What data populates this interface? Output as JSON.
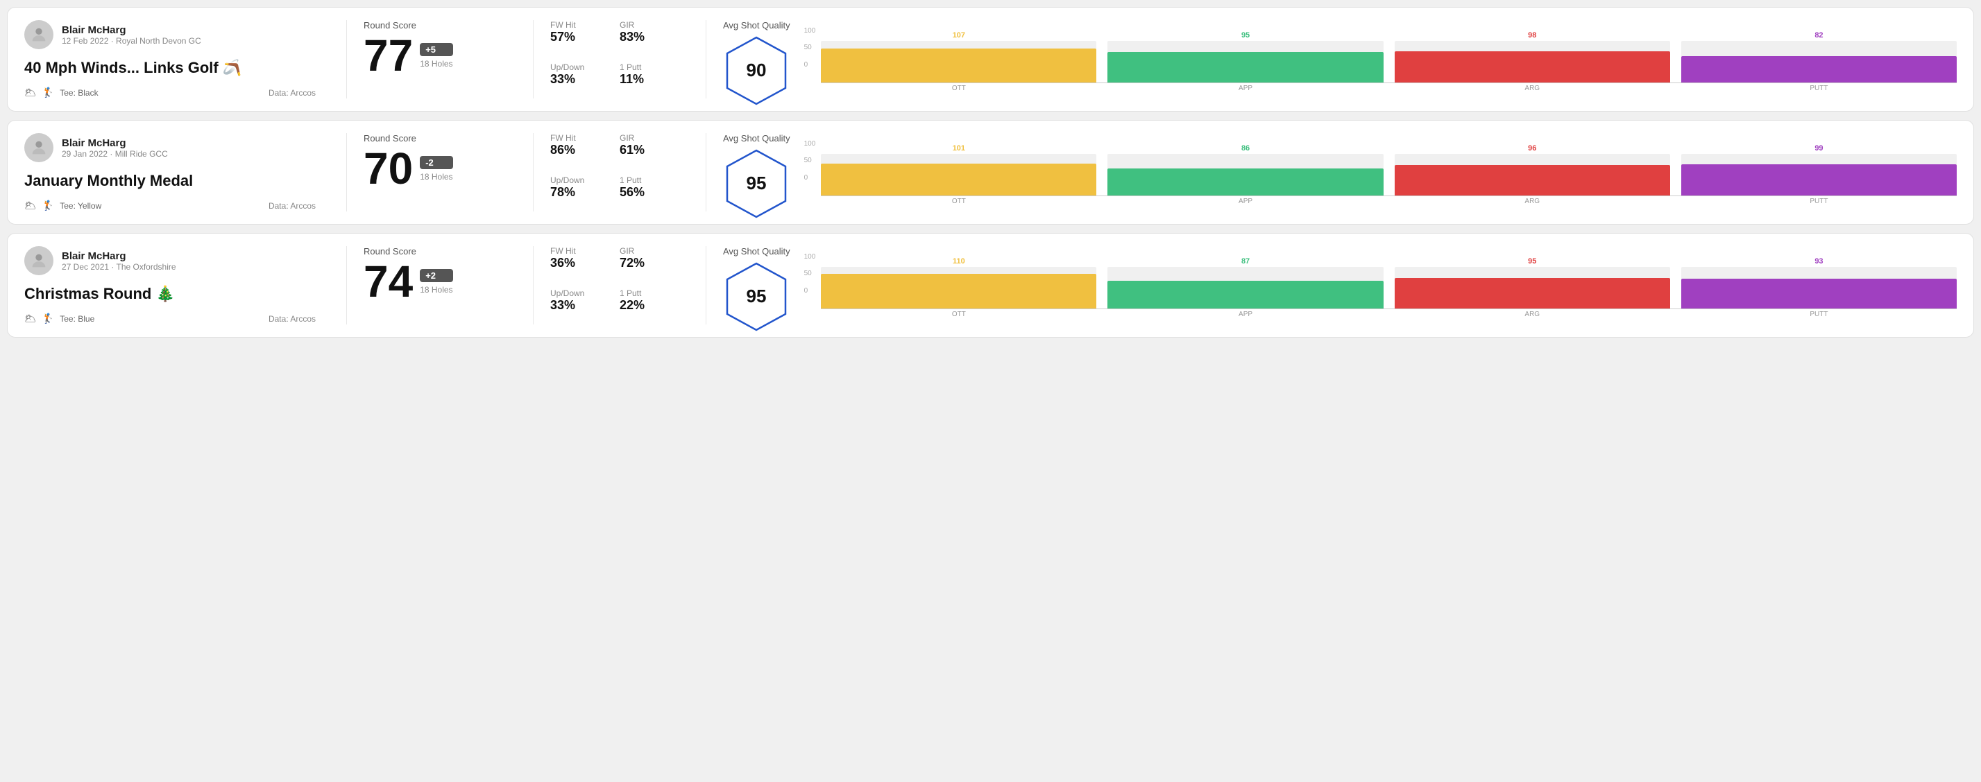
{
  "rounds": [
    {
      "id": "round-1",
      "user": {
        "name": "Blair McHarg",
        "meta": "12 Feb 2022 · Royal North Devon GC"
      },
      "title": "40 Mph Winds... Links Golf 🪃",
      "tee": "Black",
      "data_source": "Data: Arccos",
      "score": {
        "label": "Round Score",
        "number": "77",
        "badge": "+5",
        "badge_type": "plus",
        "holes": "18 Holes"
      },
      "stats": {
        "fw_hit_label": "FW Hit",
        "fw_hit_value": "57%",
        "gir_label": "GIR",
        "gir_value": "83%",
        "updown_label": "Up/Down",
        "updown_value": "33%",
        "oneputt_label": "1 Putt",
        "oneputt_value": "11%"
      },
      "quality": {
        "label": "Avg Shot Quality",
        "score": "90",
        "bars": [
          {
            "label": "OTT",
            "value": 107,
            "color_class": "bar-fill-ott",
            "text_class": "color-ott",
            "max": 120
          },
          {
            "label": "APP",
            "value": 95,
            "color_class": "bar-fill-app",
            "text_class": "color-app",
            "max": 120
          },
          {
            "label": "ARG",
            "value": 98,
            "color_class": "bar-fill-arg",
            "text_class": "color-arg",
            "max": 120
          },
          {
            "label": "PUTT",
            "value": 82,
            "color_class": "bar-fill-putt",
            "text_class": "color-putt",
            "max": 120
          }
        ]
      }
    },
    {
      "id": "round-2",
      "user": {
        "name": "Blair McHarg",
        "meta": "29 Jan 2022 · Mill Ride GCC"
      },
      "title": "January Monthly Medal",
      "tee": "Yellow",
      "data_source": "Data: Arccos",
      "score": {
        "label": "Round Score",
        "number": "70",
        "badge": "-2",
        "badge_type": "minus",
        "holes": "18 Holes"
      },
      "stats": {
        "fw_hit_label": "FW Hit",
        "fw_hit_value": "86%",
        "gir_label": "GIR",
        "gir_value": "61%",
        "updown_label": "Up/Down",
        "updown_value": "78%",
        "oneputt_label": "1 Putt",
        "oneputt_value": "56%"
      },
      "quality": {
        "label": "Avg Shot Quality",
        "score": "95",
        "bars": [
          {
            "label": "OTT",
            "value": 101,
            "color_class": "bar-fill-ott",
            "text_class": "color-ott",
            "max": 120
          },
          {
            "label": "APP",
            "value": 86,
            "color_class": "bar-fill-app",
            "text_class": "color-app",
            "max": 120
          },
          {
            "label": "ARG",
            "value": 96,
            "color_class": "bar-fill-arg",
            "text_class": "color-arg",
            "max": 120
          },
          {
            "label": "PUTT",
            "value": 99,
            "color_class": "bar-fill-putt",
            "text_class": "color-putt",
            "max": 120
          }
        ]
      }
    },
    {
      "id": "round-3",
      "user": {
        "name": "Blair McHarg",
        "meta": "27 Dec 2021 · The Oxfordshire"
      },
      "title": "Christmas Round 🎄",
      "tee": "Blue",
      "data_source": "Data: Arccos",
      "score": {
        "label": "Round Score",
        "number": "74",
        "badge": "+2",
        "badge_type": "plus",
        "holes": "18 Holes"
      },
      "stats": {
        "fw_hit_label": "FW Hit",
        "fw_hit_value": "36%",
        "gir_label": "GIR",
        "gir_value": "72%",
        "updown_label": "Up/Down",
        "updown_value": "33%",
        "oneputt_label": "1 Putt",
        "oneputt_value": "22%"
      },
      "quality": {
        "label": "Avg Shot Quality",
        "score": "95",
        "bars": [
          {
            "label": "OTT",
            "value": 110,
            "color_class": "bar-fill-ott",
            "text_class": "color-ott",
            "max": 120
          },
          {
            "label": "APP",
            "value": 87,
            "color_class": "bar-fill-app",
            "text_class": "color-app",
            "max": 120
          },
          {
            "label": "ARG",
            "value": 95,
            "color_class": "bar-fill-arg",
            "text_class": "color-arg",
            "max": 120
          },
          {
            "label": "PUTT",
            "value": 93,
            "color_class": "bar-fill-putt",
            "text_class": "color-putt",
            "max": 120
          }
        ]
      }
    }
  ],
  "y_axis": {
    "top": "100",
    "mid": "50",
    "bot": "0"
  }
}
